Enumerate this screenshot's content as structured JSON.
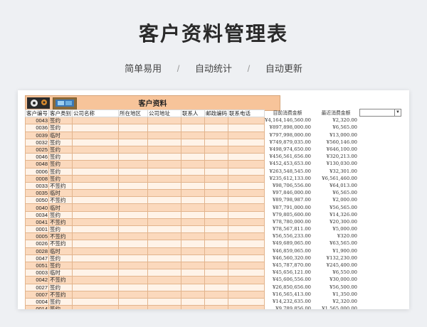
{
  "page": {
    "title": "客户资料管理表",
    "features": [
      "简单易用",
      "自动统计",
      "自动更新"
    ],
    "separator": "/"
  },
  "sheet": {
    "banner_title": "客户资料",
    "headers": [
      "客户编号",
      "客户类别",
      "公司名称",
      "所在地区",
      "公司地址",
      "联系人",
      "邮政编码",
      "联系电话"
    ],
    "amount_headers": [
      "目前消费金额",
      "最近消费金额"
    ],
    "rows": [
      {
        "code": "0043",
        "type": "签约",
        "current": "¥4,164,146,560.00",
        "recent": "¥2,320.00"
      },
      {
        "code": "0036",
        "type": "签约",
        "current": "¥897,898,000.00",
        "recent": "¥6,565.00"
      },
      {
        "code": "0039",
        "type": "临时",
        "current": "¥797,998,000.00",
        "recent": "¥13,000.00"
      },
      {
        "code": "0032",
        "type": "签约",
        "current": "¥749,879,035.00",
        "recent": "¥560,146.00"
      },
      {
        "code": "0025",
        "type": "签约",
        "current": "¥498,974,650.00",
        "recent": "¥646,100.00"
      },
      {
        "code": "0046",
        "type": "签约",
        "current": "¥456,561,656.00",
        "recent": "¥320,213.00"
      },
      {
        "code": "0048",
        "type": "签约",
        "current": "¥452,453,653.00",
        "recent": "¥130,030.00"
      },
      {
        "code": "0006",
        "type": "签约",
        "current": "¥263,548,545.00",
        "recent": "¥32,301.00"
      },
      {
        "code": "0008",
        "type": "签约",
        "current": "¥235,612,133.00",
        "recent": "¥6,561,460.00"
      },
      {
        "code": "0033",
        "type": "不签约",
        "current": "¥98,706,556.00",
        "recent": "¥64,013.00"
      },
      {
        "code": "0035",
        "type": "临时",
        "current": "¥97,846,000.00",
        "recent": "¥6,565.00"
      },
      {
        "code": "0050",
        "type": "不签约",
        "current": "¥89,798,987.00",
        "recent": "¥2,000.00"
      },
      {
        "code": "0040",
        "type": "临时",
        "current": "¥87,791,000.00",
        "recent": "¥56,565.00"
      },
      {
        "code": "0034",
        "type": "签约",
        "current": "¥79,805,600.00",
        "recent": "¥14,326.00"
      },
      {
        "code": "0041",
        "type": "不签约",
        "current": "¥78,780,000.00",
        "recent": "¥20,300.00"
      },
      {
        "code": "0001",
        "type": "签约",
        "current": "¥78,567,811.00",
        "recent": "¥5,000.00"
      },
      {
        "code": "0005",
        "type": "不签约",
        "current": "¥56,556,233.00",
        "recent": "¥320.00"
      },
      {
        "code": "0026",
        "type": "不签约",
        "current": "¥49,689,065.00",
        "recent": "¥63,565.00"
      },
      {
        "code": "0028",
        "type": "临时",
        "current": "¥46,859,065.00",
        "recent": "¥1,900.00"
      },
      {
        "code": "0047",
        "type": "签约",
        "current": "¥46,560,320.00",
        "recent": "¥132,230.00"
      },
      {
        "code": "0051",
        "type": "签约",
        "current": "¥45,787,870.00",
        "recent": "¥245,400.00"
      },
      {
        "code": "0003",
        "type": "临时",
        "current": "¥45,656,121.00",
        "recent": "¥6,550.00"
      },
      {
        "code": "0042",
        "type": "不签约",
        "current": "¥45,606,556.00",
        "recent": "¥30,000.00"
      },
      {
        "code": "0027",
        "type": "签约",
        "current": "¥26,850,656.00",
        "recent": "¥56,500.00"
      },
      {
        "code": "0007",
        "type": "不签约",
        "current": "¥16,565,413.00",
        "recent": "¥1,350.00"
      },
      {
        "code": "0004",
        "type": "签约",
        "current": "¥14,232,635.00",
        "recent": "¥2,320.00"
      },
      {
        "code": "0014",
        "type": "签约",
        "current": "¥9,789,856.00",
        "recent": "¥1,565,000.00"
      }
    ]
  },
  "icons": [
    "gear-icon",
    "monitor-icon",
    "dropdown-arrow-icon"
  ],
  "colors": {
    "row_fill": "#fbd9bd",
    "banner_fill": "#f7c49a",
    "grid_line": "#e2b48d"
  }
}
